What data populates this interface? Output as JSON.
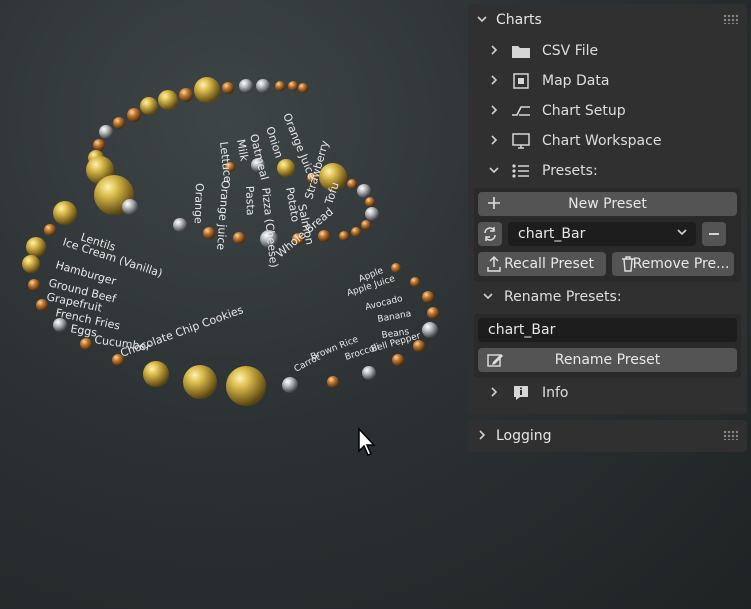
{
  "scene": {
    "outer_labels": [
      "Lentils",
      "Ice Cream (Vanilla)",
      "Hamburger",
      "Ground Beef",
      "Grapefruit",
      "French Fries",
      "Eggs",
      "Cucumber",
      "Chocolate Chip Cookies"
    ],
    "radial_labels": [
      "Lettuce",
      "Milk",
      "Oatmeal",
      "Onion",
      "Orange Juice",
      "Orange",
      "Orange juice",
      "Pasta",
      "Pizza (Cheese)",
      "Potato",
      "Salmon",
      "Strawberry",
      "Tofu",
      "Whole Bread"
    ],
    "right_labels": [
      "Apple",
      "Apple Juice",
      "Avocado",
      "Banana",
      "Beans",
      "Bell Pepper",
      "Broccoli",
      "Brown Rice",
      "Carrot"
    ]
  },
  "panel": {
    "header": {
      "title": "Charts"
    },
    "items": [
      {
        "label": "CSV File",
        "icon": "folder-icon"
      },
      {
        "label": "Map Data",
        "icon": "map-data-icon"
      },
      {
        "label": "Chart Setup",
        "icon": "chart-setup-icon"
      },
      {
        "label": "Chart Workspace",
        "icon": "monitor-icon"
      },
      {
        "label": "Presets:",
        "icon": "list-icon"
      }
    ],
    "presets": {
      "new_label": "New Preset",
      "selected": "chart_Bar",
      "recall_label": "Recall Preset",
      "remove_label": "Remove Pre..."
    },
    "rename": {
      "title": "Rename Presets:",
      "value": "chart_Bar",
      "button_label": "Rename Preset"
    },
    "info": {
      "label": "Info"
    },
    "logging": {
      "title": "Logging"
    }
  }
}
